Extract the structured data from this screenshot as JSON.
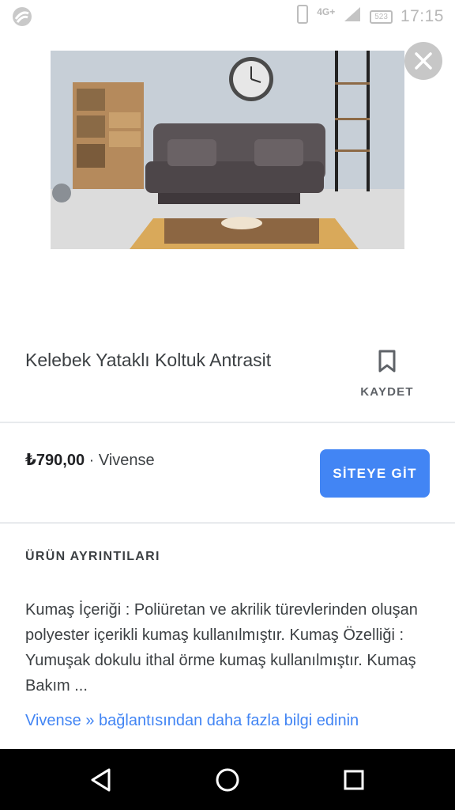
{
  "status_bar": {
    "network": "4G+",
    "battery": "523",
    "time": "17:15",
    "icons": [
      "app-logo-icon",
      "phone-icon",
      "signal-icon",
      "battery-icon"
    ]
  },
  "product": {
    "image_icon": "sofa-photo",
    "title": "Kelebek Yataklı Koltuk Antrasit",
    "save_label": "KAYDET",
    "price": "₺790,00",
    "separator": " · ",
    "seller": "Vivense",
    "cta_label": "SİTEYE GİT"
  },
  "details": {
    "section_title": "ÜRÜN AYRINTILARI",
    "description": "Kumaş İçeriği : Poliüretan ve akrilik türevlerinden oluşan polyester içerikli kumaş kullanılmıştır. Kumaş Özelliği : Yumuşak dokulu ithal örme kumaş kullanılmıştır. Kumaş Bakım ...",
    "more_link": "Vivense » bağlantısından daha fazla bilgi edinin"
  },
  "colors": {
    "accent": "#4285f4",
    "text": "#3c4043",
    "divider": "#e8eaed"
  }
}
